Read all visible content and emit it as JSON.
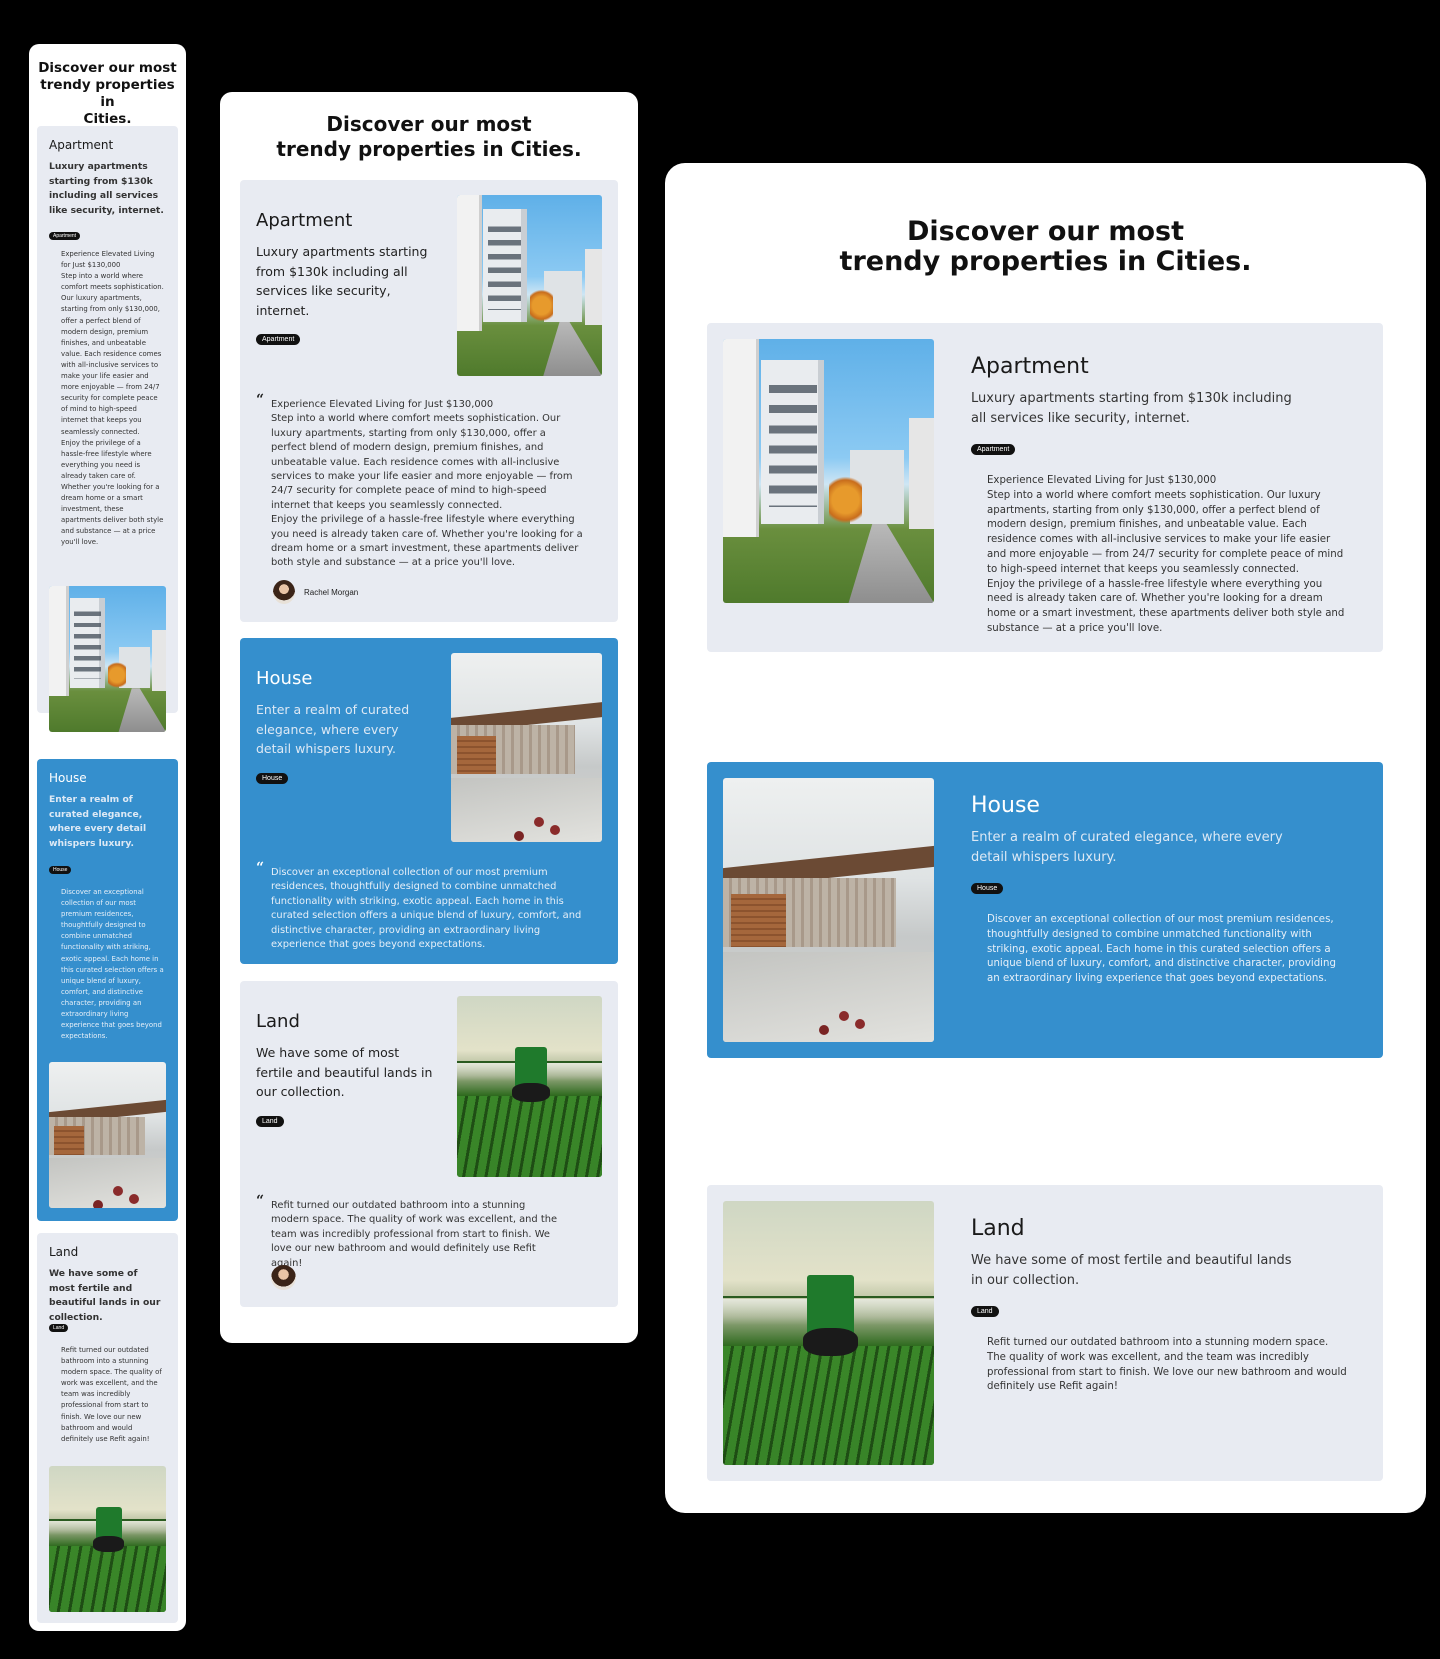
{
  "title": "Discover our most trendy properties in Cities.",
  "title_mobile": "Discover our most\ntrendy properties in\nCities.",
  "title_wide": "Discover our most\ntrendy properties in Cities.",
  "cards": [
    {
      "label": "Apartment",
      "subtitle": "Luxury apartments starting from $130k including all services like security, internet.",
      "badge": "Apartment",
      "quote": "Experience Elevated Living for Just $130,000\nStep into a world where comfort meets sophistication. Our luxury apartments, starting from only $130,000, offer a perfect blend of modern design, premium finishes, and unbeatable value. Each residence comes with all-inclusive services to make your life easier and more enjoyable — from 24/7 security for complete peace of mind to high-speed internet that keeps you seamlessly connected.\nEnjoy the privilege of a hassle-free lifestyle where everything you need is already taken care of. Whether you're looking for a dream home or a smart investment, these apartments deliver both style and substance — at a price you'll love.",
      "author": "Rachel Morgan",
      "image": "apartment-buildings-photo"
    },
    {
      "label": "House",
      "subtitle": "Enter a realm of curated elegance, where every detail whispers luxury.",
      "badge": "House",
      "quote": "Discover an exceptional collection of our most premium residences, thoughtfully designed to combine unmatched functionality with striking, exotic appeal. Each home in this curated selection offers a unique blend of luxury, comfort, and distinctive character, providing an extraordinary living experience that goes beyond expectations.",
      "image": "modern-house-photo"
    },
    {
      "label": "Land",
      "subtitle": "We have some of most fertile and beautiful lands in our collection.",
      "badge": "Land",
      "quote": "Refit turned our outdated bathroom into a stunning modern space. The quality of work was excellent, and the team was incredibly professional from start to finish. We love our new bathroom and would definitely use Refit again!",
      "image": "tractor-field-photo"
    }
  ],
  "quote_mark": "“",
  "colors": {
    "background": "#000000",
    "frame": "#ffffff",
    "card": "#e8ebf2",
    "accent_blue": "#358fcd",
    "badge": "#111111"
  }
}
